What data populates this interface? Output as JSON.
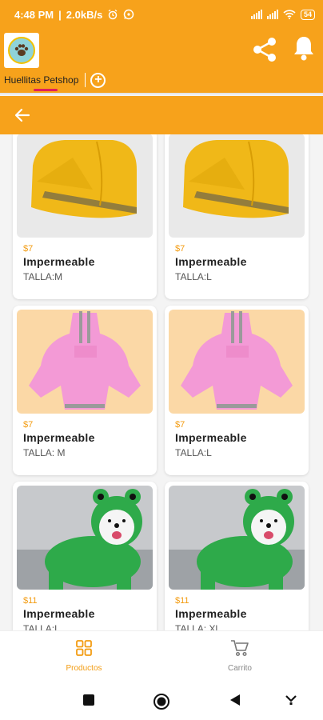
{
  "status": {
    "time": "4:48 PM",
    "speed": "2.0kB/s",
    "battery": "54"
  },
  "header": {
    "tab_label": "Huellitas Petshop",
    "add_tab": "+"
  },
  "products": [
    {
      "price": "$7",
      "name": "Impermeable",
      "size": "TALLA:M",
      "image": "yellow-raincoat"
    },
    {
      "price": "$7",
      "name": "Impermeable",
      "size": "TALLA:L",
      "image": "yellow-raincoat"
    },
    {
      "price": "$7",
      "name": "Impermeable",
      "size": "TALLA: M",
      "image": "pink-raincoat"
    },
    {
      "price": "$7",
      "name": "Impermeable",
      "size": "TALLA:L",
      "image": "pink-raincoat"
    },
    {
      "price": "$11",
      "name": "Impermeable",
      "size": "TALLA:L",
      "image": "green-frog-raincoat-dog"
    },
    {
      "price": "$11",
      "name": "Impermeable",
      "size": "TALLA: Xl",
      "image": "green-frog-raincoat-dog"
    }
  ],
  "bottom_nav": {
    "products": "Productos",
    "cart": "Carrito"
  },
  "colors": {
    "accent": "#f7a21b",
    "price": "#f39c12",
    "tab_indicator": "#e01f5b"
  }
}
